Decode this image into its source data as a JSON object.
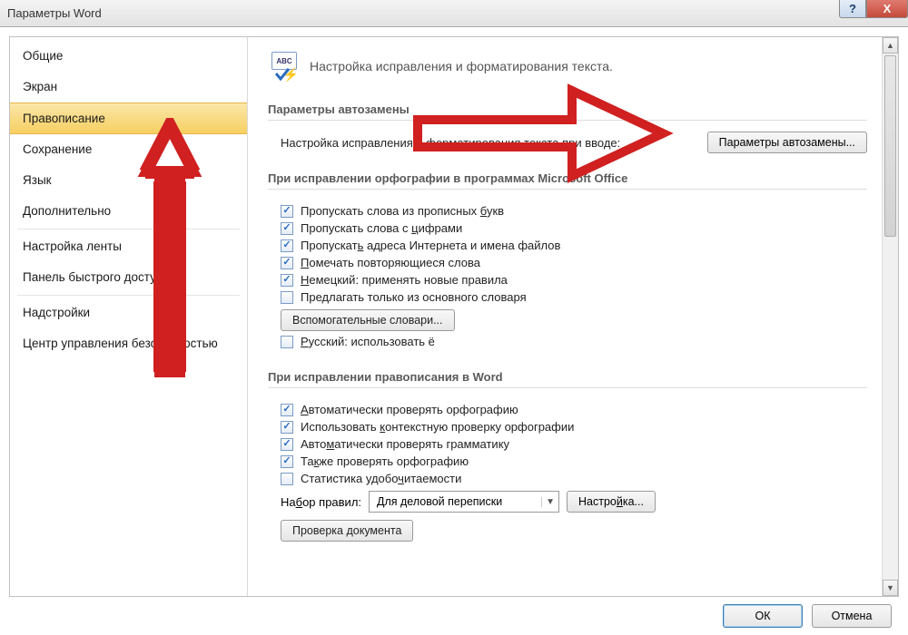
{
  "window": {
    "title": "Параметры Word"
  },
  "titlebar_controls": {
    "help": "?",
    "close": "X"
  },
  "sidebar": {
    "items": [
      {
        "label": "Общие"
      },
      {
        "label": "Экран"
      },
      {
        "label": "Правописание",
        "selected": true
      },
      {
        "label": "Сохранение"
      },
      {
        "label": "Язык"
      },
      {
        "label": "Дополнительно"
      },
      {
        "label": "Настройка ленты"
      },
      {
        "label": "Панель быстрого доступа"
      },
      {
        "label": "Надстройки"
      },
      {
        "label": "Центр управления безопасностью"
      }
    ]
  },
  "header": {
    "icon_text": "ABC",
    "text": "Настройка исправления и форматирования текста."
  },
  "group_autocorrect": {
    "title": "Параметры автозамены",
    "row_text": "Настройка исправления и форматирования текста при вводе:",
    "button": "Параметры автозамены..."
  },
  "group_office": {
    "title": "При исправлении орфографии в программах Microsoft Office",
    "checks": [
      {
        "label_html": "Пропускать слова из прописных <u>б</u>укв",
        "checked": true
      },
      {
        "label_html": "Пропускать слова с <u>ц</u>ифрами",
        "checked": true
      },
      {
        "label_html": "Пропускат<u>ь</u> адреса Интернета и имена файлов",
        "checked": true
      },
      {
        "label_html": "<u>П</u>омечать повторяющиеся слова",
        "checked": true
      },
      {
        "label_html": "<u>Н</u>емецкий: применять новые правила",
        "checked": true
      },
      {
        "label_html": "Предлагать только из основного словаря",
        "checked": false
      }
    ],
    "dict_button": "Вспомогательные словари...",
    "russian_check": {
      "label_html": "<u>Р</u>усский: использовать ё",
      "checked": false
    }
  },
  "group_word": {
    "title": "При исправлении правописания в Word",
    "checks": [
      {
        "label_html": "<u>А</u>втоматически проверять орфографию",
        "checked": true
      },
      {
        "label_html": "Использовать <u>к</u>онтекстную проверку орфографии",
        "checked": true
      },
      {
        "label_html": "Авто<u>м</u>атически проверять грамматику",
        "checked": true
      },
      {
        "label_html": "Та<u>к</u>же проверять орфографию",
        "checked": true
      },
      {
        "label_html": "Статистика удобо<u>ч</u>итаемости",
        "checked": false
      }
    ],
    "ruleset_label_html": "На<u>б</u>ор правил:",
    "ruleset_value": "Для деловой переписки",
    "settings_button": "Настро<u>й</u>ка...",
    "check_doc_button": "Проверка документа"
  },
  "footer": {
    "ok": "ОК",
    "cancel": "Отмена"
  },
  "annotation": {
    "arrow_color": "#d02020"
  }
}
